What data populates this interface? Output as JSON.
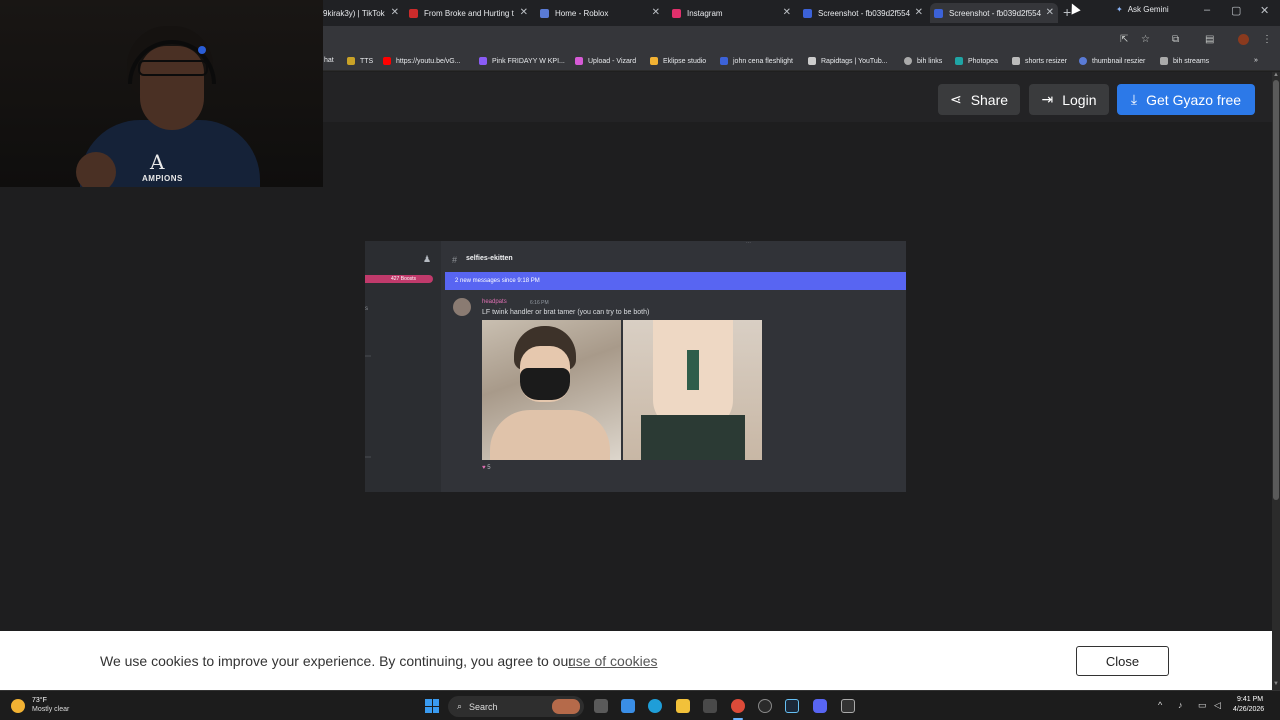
{
  "browser": {
    "tabs": [
      {
        "title": "9kirak3y) | TikTok",
        "color": "#111111"
      },
      {
        "title": "From Broke and Hurting t",
        "color": "#cc2b2b"
      },
      {
        "title": "Home - Roblox",
        "color": "#5a7bd6"
      },
      {
        "title": "Instagram",
        "color": "#e1306c"
      },
      {
        "title": "Screenshot - fb039d2f554",
        "color": "#3c62d8"
      },
      {
        "title": "Screenshot - fb039d2f554",
        "color": "#3c62d8"
      }
    ],
    "active_tab_index": 5,
    "new_tab_icon": "plus-icon",
    "ask_gemini_label": "Ask Gemini",
    "bookmarks": [
      {
        "label": "hat",
        "color": "#7a7a7a"
      },
      {
        "label": "TTS",
        "color": "#c9a227"
      },
      {
        "label": "https://youtu.be/vG...",
        "color": "#ff0000"
      },
      {
        "label": "Pink FRIDAYY W KPI...",
        "color": "#8a5cf6"
      },
      {
        "label": "Upload - Vizard",
        "color": "#d65ad6"
      },
      {
        "label": "Eklipse studio",
        "color": "#f2b233"
      },
      {
        "label": "john cena fleshlight",
        "color": "#3c62d8"
      },
      {
        "label": "Rapidtags | YouTub...",
        "color": "#cccccc"
      },
      {
        "label": "bih links",
        "color": "#aaaaaa"
      },
      {
        "label": "Photopea",
        "color": "#1fa5a5"
      },
      {
        "label": "shorts resizer",
        "color": "#bbbbbb"
      },
      {
        "label": "thumbnail reszier",
        "color": "#5a7bd6"
      },
      {
        "label": "bih streams",
        "color": "#aaaaaa"
      }
    ]
  },
  "gyazo": {
    "share_label": "Share",
    "login_label": "Login",
    "get_label": "Get Gyazo free",
    "accent_color": "#2c79e8"
  },
  "screenshot": {
    "channel_name": "selfies-ekitten",
    "boost_text": "427 Boosts",
    "new_messages_banner": "2 new messages since 9:18 PM",
    "author": "headpats",
    "timestamp": "6:16 PM",
    "message": "LF twink handler or brat tamer (you can try to be both)",
    "reaction_count": "5"
  },
  "cookie": {
    "text": "We use cookies to improve your experience. By continuing, you agree to our",
    "link": "use of cookies",
    "close_label": "Close"
  },
  "taskbar": {
    "weather_temp": "73°F",
    "weather_desc": "Mostly clear",
    "search_label": "Search",
    "time": "9:41 PM",
    "date": "4/26/2026"
  },
  "webcam": {
    "shirt_text": "AMPIONS"
  }
}
